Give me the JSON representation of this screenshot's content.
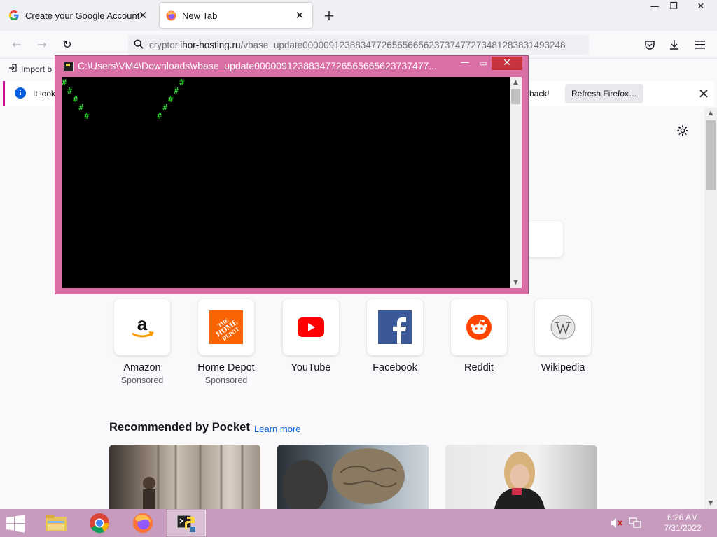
{
  "browser": {
    "tabs": [
      {
        "label": "Create your Google Account",
        "favicon": "google-icon",
        "active": false
      },
      {
        "label": "New Tab",
        "favicon": "firefox-icon",
        "active": true
      }
    ],
    "url": {
      "prefix": "cryptor.",
      "host": "ihor-hosting.ru",
      "path": "/vbase_update00000912388347726565665623737477273481283831493248"
    },
    "bookmarks": {
      "import_label": "Import b"
    },
    "notification": {
      "text_left": "It look",
      "text_right": "back!",
      "button_label": "Refresh Firefox…"
    }
  },
  "console": {
    "title": "C:\\Users\\VM4\\Downloads\\vbase_update00000912388347726565665623737477..."
  },
  "top_sites": [
    {
      "name": "Amazon",
      "sub": "Sponsored",
      "icon": "amazon-icon"
    },
    {
      "name": "Home Depot",
      "sub": "Sponsored",
      "icon": "home-depot-icon"
    },
    {
      "name": "YouTube",
      "sub": "",
      "icon": "youtube-icon"
    },
    {
      "name": "Facebook",
      "sub": "",
      "icon": "facebook-icon"
    },
    {
      "name": "Reddit",
      "sub": "",
      "icon": "reddit-icon"
    },
    {
      "name": "Wikipedia",
      "sub": "",
      "icon": "wikipedia-icon"
    }
  ],
  "home_depot_logo_text": "THE HOME DEPOT",
  "pocket": {
    "title": "Recommended by Pocket",
    "link": "Learn more"
  },
  "taskbar": {
    "time": "6:26 AM",
    "date": "7/31/2022"
  },
  "colors": {
    "console_frame": "#d96fa5",
    "taskbar": "#c79bbd",
    "console_text": "#38f138",
    "accent_link": "#0061e0"
  }
}
